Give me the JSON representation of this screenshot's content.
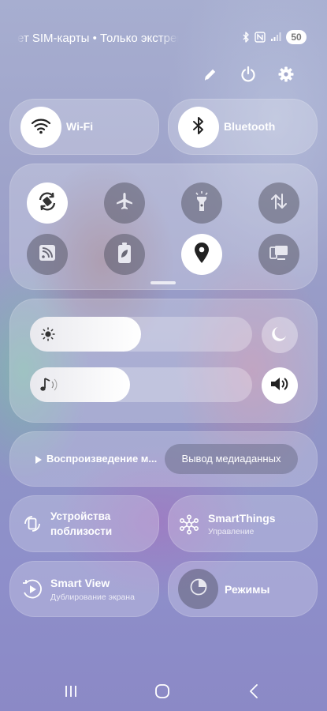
{
  "status_bar": {
    "notification_text": "ет SIM-карты • Только экстренные",
    "battery_level": "50",
    "icons": [
      "bluetooth-icon",
      "nfc-icon",
      "signal-icon"
    ]
  },
  "top_actions": {
    "icons": [
      "pencil-icon",
      "power-icon",
      "gear-icon"
    ]
  },
  "wifi": {
    "label": "Wi-Fi",
    "state": "on"
  },
  "bluetooth": {
    "label": "Bluetooth",
    "state": "on"
  },
  "quick_toggles": [
    {
      "icon": "auto-rotate-icon",
      "state": "on"
    },
    {
      "icon": "airplane-icon",
      "state": "off"
    },
    {
      "icon": "flashlight-icon",
      "state": "off"
    },
    {
      "icon": "mobile-data-icon",
      "state": "off"
    },
    {
      "icon": "cast-icon",
      "state": "off"
    },
    {
      "icon": "power-saving-icon",
      "state": "off"
    },
    {
      "icon": "location-icon",
      "state": "on"
    },
    {
      "icon": "device-sync-icon",
      "state": "off"
    }
  ],
  "brightness": {
    "level": 0.5,
    "icon": "sun-icon",
    "side_icon": "moon-icon"
  },
  "volume": {
    "level": 0.45,
    "icon": "music-note-icon",
    "side_icon": "speaker-icon"
  },
  "media": {
    "now_playing": "Воспроизведение м...",
    "output_button": "Вывод медиаданных"
  },
  "tiles": {
    "nearby_devices": {
      "title": "Устройства поблизости",
      "subtitle": ""
    },
    "smartthings": {
      "title": "SmartThings",
      "subtitle": "Управление"
    },
    "smart_view": {
      "title": "Smart View",
      "subtitle": "Дублирование экрана"
    },
    "modes": {
      "title": "Режимы",
      "subtitle": ""
    }
  },
  "colors": {
    "accent_white": "#ffffff",
    "off_toggle": "#5a5a69",
    "panel": "rgba(255,255,255,0.22)"
  }
}
